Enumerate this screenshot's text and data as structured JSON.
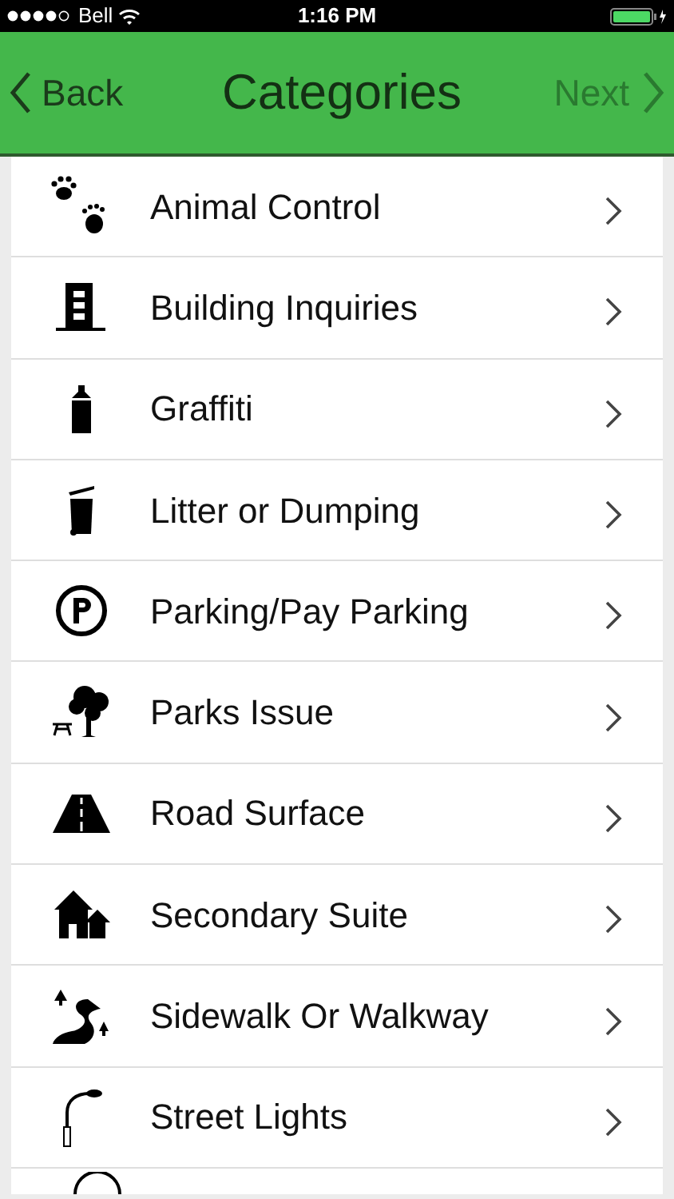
{
  "status_bar": {
    "carrier": "Bell",
    "time": "1:16 PM"
  },
  "nav": {
    "back": "Back",
    "title": "Categories",
    "next": {
      "label": "Next",
      "disabled": true
    }
  },
  "categories": [
    {
      "label": "Animal Control"
    },
    {
      "label": "Building Inquiries"
    },
    {
      "label": "Graffiti"
    },
    {
      "label": "Litter or Dumping"
    },
    {
      "label": "Parking/Pay Parking"
    },
    {
      "label": "Parks Issue"
    },
    {
      "label": "Road Surface"
    },
    {
      "label": "Secondary Suite"
    },
    {
      "label": "Sidewalk Or Walkway"
    },
    {
      "label": "Street Lights"
    }
  ]
}
